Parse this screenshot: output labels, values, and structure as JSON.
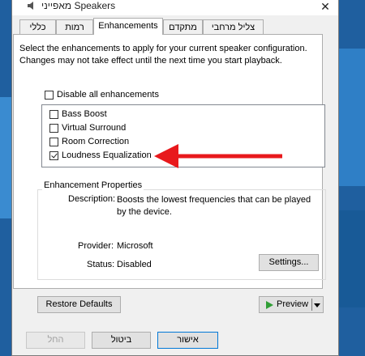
{
  "window": {
    "title": "מאפייני Speakers",
    "close_glyph": "✕"
  },
  "tabs": [
    {
      "label": "כללי"
    },
    {
      "label": "רמות"
    },
    {
      "label": "Enhancements",
      "active": true
    },
    {
      "label": "מתקדם"
    },
    {
      "label": "צליל מרחבי"
    }
  ],
  "intro_text": "Select the enhancements to apply for your current speaker configuration. Changes may not take effect until the next time you start playback.",
  "disable_all": {
    "label": "Disable all enhancements",
    "checked": false
  },
  "enhancements": [
    {
      "label": "Bass Boost",
      "checked": false
    },
    {
      "label": "Virtual Surround",
      "checked": false
    },
    {
      "label": "Room Correction",
      "checked": false
    },
    {
      "label": "Loudness Equalization",
      "checked": true
    }
  ],
  "properties": {
    "group_title": "Enhancement Properties",
    "description_label": "Description:",
    "description_value": "Boosts the lowest frequencies that can be played by the device.",
    "provider_label": "Provider:",
    "provider_value": "Microsoft",
    "status_label": "Status:",
    "status_value": "Disabled",
    "settings_button": "Settings..."
  },
  "restore_button": "Restore Defaults",
  "preview_button": "Preview",
  "footer": {
    "ok": "אישור",
    "cancel": "ביטול",
    "apply": "החל"
  },
  "colors": {
    "annotation_arrow": "#e8191c",
    "accent": "#0078d7",
    "play_icon": "#2f9e35"
  },
  "icons": {
    "title": "speaker-icon",
    "preview": "play-icon",
    "dropdown": "chevron-down-icon",
    "annotation": "red-arrow-icon"
  }
}
